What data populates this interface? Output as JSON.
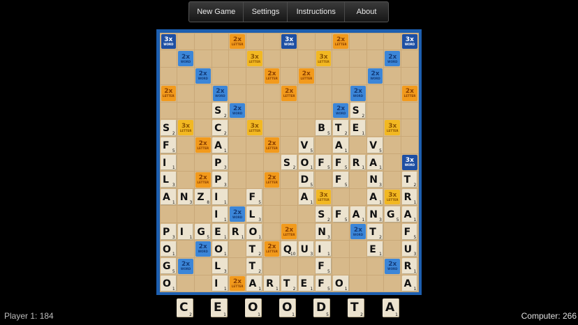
{
  "menu": {
    "items": [
      "New Game",
      "Settings",
      "Instructions",
      "About"
    ]
  },
  "scores": {
    "player": "Player 1: 184",
    "computer": "Computer: 266"
  },
  "premium_labels": {
    "W3": {
      "value": "3x",
      "text": "WORD"
    },
    "W2": {
      "value": "2x",
      "text": "WORD"
    },
    "L3": {
      "value": "3x",
      "text": "LETTER"
    },
    "L2": {
      "value": "2x",
      "text": "LETTER"
    }
  },
  "board_premiums": [
    "W3 . . . L2 . . W3 . . L2 . . . W3",
    ". W2 . . . L3 . . . L3 . . . W2 .",
    ". . W2 . . . L2 . L2 . . . W2 . .",
    "L2 . . W2 . . . L2 . . . W2 . . L2",
    ". . . . W2 . . . . . W2 . . . .",
    ". L3 . . . L3 . . . L3 . . . L3 .",
    ". . L2 . . . L2 . L2 . . . L2 . .",
    "W3 . . L2 . . . W2 . . . L2 . . W3",
    ". . L2 . . . L2 . L2 . . . L2 . .",
    ". L3 . . . L3 . . . L3 . . . L3 .",
    ". . . . W2 . . . . . W2 . . . .",
    "L2 . . W2 . . . L2 . . . W2 . . L2",
    ". . W2 . . . L2 . L2 . . . W2 . .",
    ". W2 . . . L3 . . . L3 . . . W2 .",
    "W3 . . . L2 . . W3 . . L2 . . . W3"
  ],
  "board_tiles": [
    "...............",
    "...............",
    "...............",
    "...............",
    "...S.......S...",
    "S..C.....BTE...",
    "F..A.....V.A.V.",
    "I..P....SOFFRA.",
    "L..P.....D.F.N.T",
    "ANZI.F...A...A.R",
    "...I.L...SFANGA",
    "PIGERO...N...T.F",
    "O..O..T..QUI..E.U",
    "G..L..T......F..R",
    "O..I..ARTEFO...A"
  ],
  "tile_list": [
    {
      "r": 4,
      "c": 3,
      "l": "S",
      "n": "2"
    },
    {
      "r": 4,
      "c": 11,
      "l": "S",
      "n": "2"
    },
    {
      "r": 5,
      "c": 0,
      "l": "S",
      "n": "2"
    },
    {
      "r": 5,
      "c": 3,
      "l": "C",
      "n": "2"
    },
    {
      "r": 5,
      "c": 9,
      "l": "B",
      "n": "5"
    },
    {
      "r": 5,
      "c": 10,
      "l": "T",
      "n": "2"
    },
    {
      "r": 5,
      "c": 11,
      "l": "E",
      "n": "1"
    },
    {
      "r": 6,
      "c": 0,
      "l": "F",
      "n": "5"
    },
    {
      "r": 6,
      "c": 3,
      "l": "A",
      "n": "1"
    },
    {
      "r": 6,
      "c": 8,
      "l": "V",
      "n": "5"
    },
    {
      "r": 6,
      "c": 10,
      "l": "A",
      "n": "1"
    },
    {
      "r": 6,
      "c": 12,
      "l": "V",
      "n": "5"
    },
    {
      "r": 7,
      "c": 0,
      "l": "I",
      "n": "1"
    },
    {
      "r": 7,
      "c": 3,
      "l": "P",
      "n": "3"
    },
    {
      "r": 7,
      "c": 7,
      "l": "S",
      "n": "2"
    },
    {
      "r": 7,
      "c": 8,
      "l": "O",
      "n": "1"
    },
    {
      "r": 7,
      "c": 9,
      "l": "F",
      "n": "5"
    },
    {
      "r": 7,
      "c": 10,
      "l": "F",
      "n": "5"
    },
    {
      "r": 7,
      "c": 11,
      "l": "R",
      "n": "1"
    },
    {
      "r": 7,
      "c": 12,
      "l": "A",
      "n": "1"
    },
    {
      "r": 8,
      "c": 0,
      "l": "L",
      "n": "3"
    },
    {
      "r": 8,
      "c": 3,
      "l": "P",
      "n": "3"
    },
    {
      "r": 8,
      "c": 8,
      "l": "D",
      "n": "5"
    },
    {
      "r": 8,
      "c": 10,
      "l": "F",
      "n": "5"
    },
    {
      "r": 8,
      "c": 12,
      "l": "N",
      "n": "3"
    },
    {
      "r": 8,
      "c": 14,
      "l": "T",
      "n": "2"
    },
    {
      "r": 9,
      "c": 0,
      "l": "A",
      "n": "1"
    },
    {
      "r": 9,
      "c": 1,
      "l": "N",
      "n": "3"
    },
    {
      "r": 9,
      "c": 2,
      "l": "Z",
      "n": "8"
    },
    {
      "r": 9,
      "c": 3,
      "l": "I",
      "n": "1"
    },
    {
      "r": 9,
      "c": 5,
      "l": "F",
      "n": "5"
    },
    {
      "r": 9,
      "c": 8,
      "l": "A",
      "n": "1"
    },
    {
      "r": 9,
      "c": 12,
      "l": "A",
      "n": "1"
    },
    {
      "r": 9,
      "c": 14,
      "l": "R",
      "n": "1"
    },
    {
      "r": 10,
      "c": 3,
      "l": "I",
      "n": "1"
    },
    {
      "r": 10,
      "c": 5,
      "l": "L",
      "n": "3"
    },
    {
      "r": 10,
      "c": 9,
      "l": "S",
      "n": "2"
    },
    {
      "r": 10,
      "c": 10,
      "l": "F",
      "n": "5"
    },
    {
      "r": 10,
      "c": 11,
      "l": "A",
      "n": "1"
    },
    {
      "r": 10,
      "c": 12,
      "l": "N",
      "n": "3"
    },
    {
      "r": 10,
      "c": 13,
      "l": "G",
      "n": "5"
    },
    {
      "r": 10,
      "c": 14,
      "l": "A",
      "n": "1"
    },
    {
      "r": 11,
      "c": 0,
      "l": "P",
      "n": "3"
    },
    {
      "r": 11,
      "c": 1,
      "l": "I",
      "n": "1"
    },
    {
      "r": 11,
      "c": 2,
      "l": "G",
      "n": "5"
    },
    {
      "r": 11,
      "c": 3,
      "l": "E",
      "n": "1"
    },
    {
      "r": 11,
      "c": 4,
      "l": "R",
      "n": "1"
    },
    {
      "r": 11,
      "c": 5,
      "l": "O",
      "n": "1"
    },
    {
      "r": 11,
      "c": 9,
      "l": "N",
      "n": "3"
    },
    {
      "r": 11,
      "c": 12,
      "l": "T",
      "n": "2"
    },
    {
      "r": 11,
      "c": 14,
      "l": "F",
      "n": "5"
    },
    {
      "r": 12,
      "c": 0,
      "l": "O",
      "n": "1"
    },
    {
      "r": 12,
      "c": 3,
      "l": "O",
      "n": "1"
    },
    {
      "r": 12,
      "c": 5,
      "l": "T",
      "n": "2"
    },
    {
      "r": 12,
      "c": 7,
      "l": "Q",
      "n": "10"
    },
    {
      "r": 12,
      "c": 8,
      "l": "U",
      "n": "3"
    },
    {
      "r": 12,
      "c": 9,
      "l": "I",
      "n": "1"
    },
    {
      "r": 12,
      "c": 12,
      "l": "E",
      "n": "1"
    },
    {
      "r": 12,
      "c": 14,
      "l": "U",
      "n": "3"
    },
    {
      "r": 13,
      "c": 0,
      "l": "G",
      "n": "5"
    },
    {
      "r": 13,
      "c": 3,
      "l": "L",
      "n": "3"
    },
    {
      "r": 13,
      "c": 5,
      "l": "T",
      "n": "2"
    },
    {
      "r": 13,
      "c": 9,
      "l": "F",
      "n": "5"
    },
    {
      "r": 13,
      "c": 14,
      "l": "R",
      "n": "1"
    },
    {
      "r": 14,
      "c": 0,
      "l": "O",
      "n": "1"
    },
    {
      "r": 14,
      "c": 3,
      "l": "I",
      "n": "1"
    },
    {
      "r": 14,
      "c": 5,
      "l": "A",
      "n": "1"
    },
    {
      "r": 14,
      "c": 6,
      "l": "R",
      "n": "1"
    },
    {
      "r": 14,
      "c": 7,
      "l": "T",
      "n": "2"
    },
    {
      "r": 14,
      "c": 8,
      "l": "E",
      "n": "1"
    },
    {
      "r": 14,
      "c": 9,
      "l": "F",
      "n": "5"
    },
    {
      "r": 14,
      "c": 10,
      "l": "O",
      "n": "1"
    },
    {
      "r": 14,
      "c": 14,
      "l": "A",
      "n": "1"
    }
  ],
  "rack": [
    {
      "l": "C",
      "n": "2"
    },
    {
      "l": "E",
      "n": "1"
    },
    {
      "l": "O",
      "n": "1"
    },
    {
      "l": "O",
      "n": "1"
    },
    {
      "l": "D",
      "n": "5"
    },
    {
      "l": "T",
      "n": "2"
    },
    {
      "l": "A",
      "n": "1"
    }
  ],
  "colors": {
    "board_frame": "#1d5fb0",
    "square": "#d7b98a",
    "tile": "#ece3cf",
    "w3": "#1e4fa3",
    "w2": "#3c86d8",
    "l3": "#f2b822",
    "l2": "#f29a1c"
  }
}
